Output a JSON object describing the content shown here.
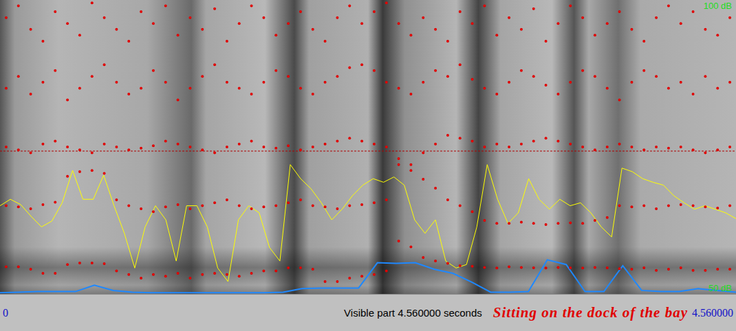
{
  "chart": {
    "frequency_axis": {
      "min": 0,
      "max": 5000,
      "reference_line": 2430
    },
    "pitch_axis": {
      "min": 0,
      "max": 500
    },
    "intensity_axis": {
      "min": 50,
      "max": 100,
      "min_label": "50 dB",
      "max_label": "100 dB"
    },
    "formants": [
      {
        "values": [
          460,
          460,
          420,
          350,
          350,
          500,
          525,
          525,
          515,
          390,
          330,
          270,
          330,
          300,
          350,
          270,
          330,
          350,
          330,
          300,
          350,
          390,
          390,
          445,
          445,
          420,
          210,
          210,
          270,
          300,
          330,
          390,
          900,
          800,
          620,
          560,
          520,
          480,
          470,
          450,
          440,
          460,
          450,
          445,
          440,
          450,
          445,
          440,
          450,
          445,
          430,
          420,
          445,
          400,
          420,
          445,
          400,
          400,
          420,
          420
        ]
      },
      {
        "values": [
          1500,
          1480,
          1450,
          1520,
          1560,
          2000,
          2080,
          2100,
          2050,
          1600,
          1500,
          1450,
          1400,
          1480,
          1520,
          1450,
          1500,
          1550,
          1600,
          1500,
          1450,
          1480,
          1500,
          1550,
          1600,
          1500,
          1480,
          1450,
          1500,
          1520,
          1550,
          1600,
          2200,
          2100,
          1950,
          1800,
          1600,
          1500,
          1400,
          1250,
          1200,
          1200,
          1220,
          1200,
          1180,
          1200,
          1210,
          1200,
          1250,
          1300,
          1500,
          1480,
          1500,
          1450,
          1500,
          1520,
          1500,
          1480,
          1460,
          1500
        ]
      },
      {
        "values": [
          2500,
          2450,
          2400,
          2550,
          2600,
          2500,
          2450,
          2400,
          2550,
          2500,
          2450,
          2480,
          2520,
          2600,
          2550,
          2500,
          2450,
          2400,
          2500,
          2550,
          2600,
          2500,
          2480,
          2520,
          2450,
          2500,
          2550,
          2600,
          2650,
          2600,
          2550,
          2500,
          2300,
          2200,
          2400,
          2550,
          2700,
          2650,
          2600,
          2500,
          2550,
          2500,
          2550,
          2600,
          2650,
          2600,
          2550,
          2500,
          2450,
          2500,
          2550,
          2500,
          2450,
          2500,
          2480,
          2500,
          2450,
          2400,
          2450,
          2500
        ]
      },
      {
        "values": [
          3500,
          3700,
          3400,
          3600,
          3800,
          3300,
          3500,
          3700,
          3900,
          3600,
          3400,
          3500,
          3800,
          3600,
          3300,
          3500,
          3700,
          3900,
          3600,
          3500,
          3400,
          3600,
          3800,
          3700,
          3500,
          3400,
          3600,
          3700,
          3850,
          3900,
          3800,
          3600,
          3500,
          3400,
          3600,
          3800,
          3700,
          3900,
          3650,
          3500,
          3400,
          3600,
          3800,
          3700,
          3550,
          3400,
          3600,
          3800,
          3700,
          3500,
          3300,
          3600,
          3800,
          3700,
          3500,
          3600,
          3400,
          3700,
          3500,
          3600
        ]
      },
      {
        "values": [
          4700,
          4900,
          4500,
          4300,
          4800,
          4600,
          4400,
          4950,
          4700,
          4500,
          4300,
          4800,
          4600,
          4900,
          4400,
          4700,
          4500,
          4850,
          4300,
          4600,
          4900,
          4700,
          4400,
          4600,
          4800,
          4500,
          4300,
          4700,
          4900,
          4600,
          4800,
          4950,
          4600,
          4400,
          4700,
          4500,
          4300,
          4800,
          4600,
          4900,
          4400,
          4700,
          4500,
          4850,
          4300,
          4600,
          4900,
          4700,
          4400,
          4600,
          4800,
          4500,
          4300,
          4700,
          4900,
          4600,
          4800,
          4500,
          4400,
          4700
        ]
      }
    ],
    "pitch": {
      "values": [
        150,
        161,
        152,
        132,
        114,
        124,
        155,
        210,
        161,
        161,
        202,
        150,
        103,
        44,
        114,
        150,
        126,
        56,
        150,
        150,
        114,
        44,
        21,
        126,
        150,
        138,
        79,
        56,
        220,
        196,
        179,
        155,
        126,
        144,
        167,
        185,
        196,
        190,
        199,
        185,
        126,
        103,
        126,
        56,
        44,
        50,
        114,
        220,
        161,
        120,
        138,
        196,
        161,
        144,
        161,
        150,
        155,
        138,
        114,
        97,
        214,
        208,
        196,
        190,
        185,
        167,
        155,
        144,
        150,
        144,
        138,
        128
      ]
    },
    "intensity": {
      "values": [
        50.2,
        50.3,
        50.4,
        50.4,
        50.4,
        51.5,
        50.6,
        50.3,
        50.2,
        50.2,
        50.2,
        50.2,
        50.2,
        50.2,
        50.2,
        50.3,
        50.9,
        51.0,
        51.0,
        51.0,
        55.3,
        55.2,
        55.3,
        54.2,
        53.5,
        52.0,
        50.3,
        50.3,
        50.4,
        55.8,
        55.0,
        50.4,
        50.4,
        54.8,
        50.6,
        50.4,
        50.4,
        50.9,
        50.6,
        50.3
      ]
    }
  },
  "status_bar": {
    "start_time": "0",
    "visible_part": "Visible part 4.560000 seconds",
    "title": "Sitting on the dock of the bay",
    "end_time": "4.560000"
  }
}
